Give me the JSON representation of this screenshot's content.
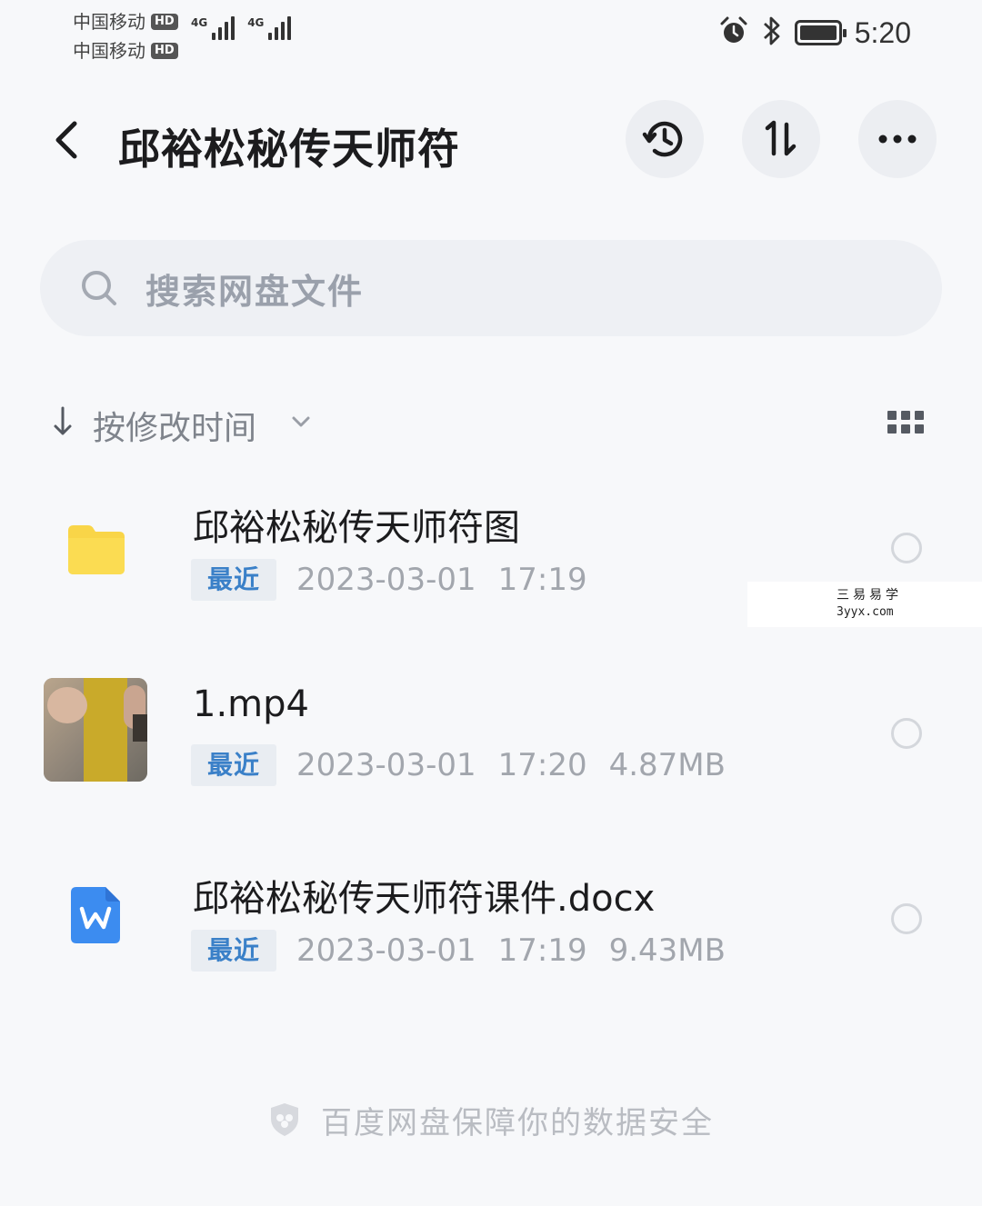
{
  "status_bar": {
    "carrier_1": "中国移动",
    "carrier_2": "中国移动",
    "hd_label": "HD",
    "network_1": "4G",
    "network_2": "4G",
    "time": "5:20",
    "icons": [
      "alarm-icon",
      "bluetooth-icon",
      "battery-icon"
    ]
  },
  "header": {
    "title": "邱裕松秘传天师符",
    "icons": [
      "back-chevron-icon",
      "history-icon",
      "sort-transfer-icon",
      "more-dots-icon"
    ]
  },
  "search": {
    "placeholder": "搜索网盘文件"
  },
  "sort": {
    "label": "按修改时间",
    "icons": [
      "sort-down-arrow-icon",
      "chevron-down-icon",
      "grid-view-icon"
    ]
  },
  "files": [
    {
      "name": "邱裕松秘传天师符图",
      "type": "folder",
      "tag": "最近",
      "date": "2023-03-01",
      "time": "17:19",
      "size": "",
      "icon": "folder-icon",
      "icon_color": "#f9d548"
    },
    {
      "name": "1.mp4",
      "type": "video",
      "tag": "最近",
      "date": "2023-03-01",
      "time": "17:20",
      "size": "4.87MB",
      "icon": "video-thumbnail"
    },
    {
      "name": "邱裕松秘传天师符课件.docx",
      "type": "docx",
      "tag": "最近",
      "date": "2023-03-01",
      "time": "17:19",
      "size": "9.43MB",
      "icon": "word-doc-icon",
      "icon_color": "#3c8cf0"
    }
  ],
  "watermark": {
    "line_1": "三易易学",
    "line_2": "3yyx.com"
  },
  "footer": {
    "text": "百度网盘保障你的数据安全",
    "icon": "shield-icon"
  },
  "colors": {
    "background": "#f7f8fa",
    "tag_text": "#3a80c8",
    "tag_bg": "#e9edf2",
    "folder": "#f9d548",
    "word": "#3c8cf0"
  }
}
